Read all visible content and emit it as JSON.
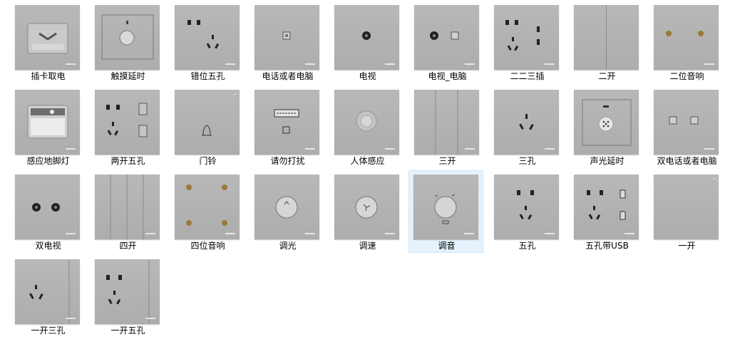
{
  "items": [
    {
      "label": "插卡取电"
    },
    {
      "label": "触摸延时"
    },
    {
      "label": "错位五孔"
    },
    {
      "label": "电话或者电脑"
    },
    {
      "label": "电视"
    },
    {
      "label": "电视_电脑"
    },
    {
      "label": "二二三插"
    },
    {
      "label": "二开"
    },
    {
      "label": "二位音响"
    },
    {
      "label": "感应地脚灯"
    },
    {
      "label": "两开五孔"
    },
    {
      "label": "门铃"
    },
    {
      "label": "请勿打扰"
    },
    {
      "label": "人体感应"
    },
    {
      "label": "三开"
    },
    {
      "label": "三孔"
    },
    {
      "label": "声光延时"
    },
    {
      "label": "双电话或者电脑"
    },
    {
      "label": "双电视"
    },
    {
      "label": "四开"
    },
    {
      "label": "四位音响"
    },
    {
      "label": "调光"
    },
    {
      "label": "调速"
    },
    {
      "label": "调音",
      "selected": true
    },
    {
      "label": "五孔"
    },
    {
      "label": "五孔带USB"
    },
    {
      "label": "一开"
    },
    {
      "label": "一开三孔"
    },
    {
      "label": "一开五孔"
    }
  ],
  "colors": {
    "selection_bg": "#e5f1fb",
    "selection_border": "#cde8ff",
    "panel_gray": "#b3b3b3"
  }
}
